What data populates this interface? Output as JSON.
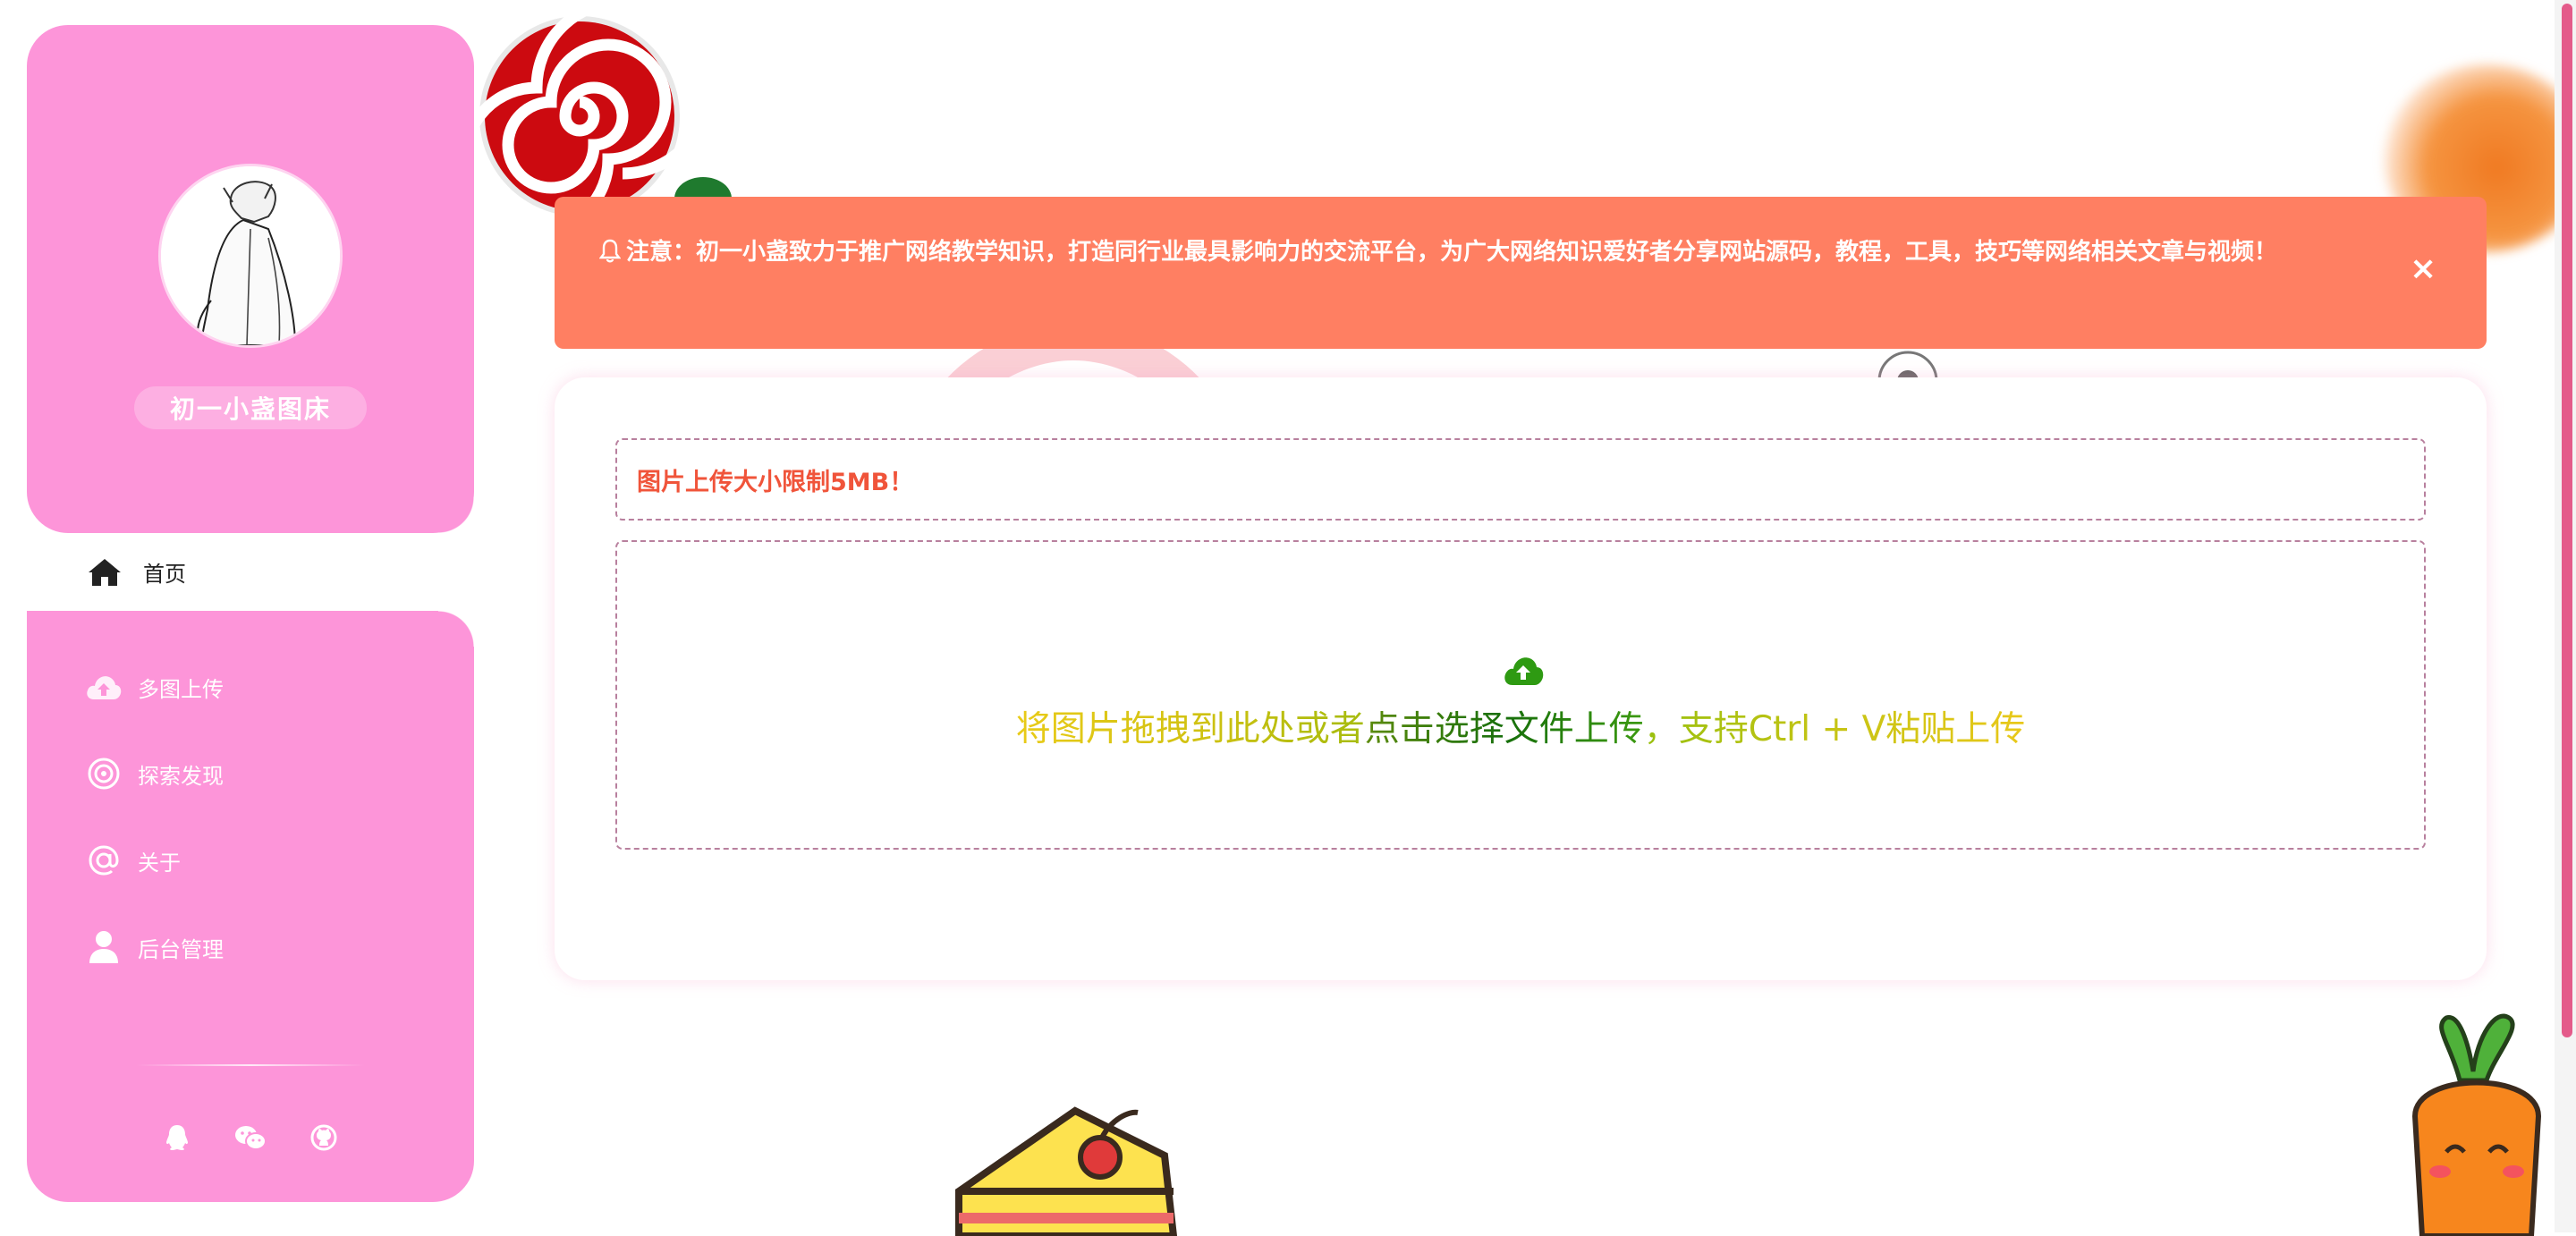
{
  "sidebar": {
    "site_name": "初一小盏图床",
    "nav": [
      {
        "label": "首页",
        "icon": "home-icon",
        "active": true
      },
      {
        "label": "多图上传",
        "icon": "cloud-upload-icon"
      },
      {
        "label": "探索发现",
        "icon": "target-icon"
      },
      {
        "label": "关于",
        "icon": "at-icon"
      },
      {
        "label": "后台管理",
        "icon": "user-icon"
      }
    ],
    "social": [
      "qq-icon",
      "wechat-icon",
      "github-icon"
    ]
  },
  "notice": {
    "text": "注意：初一小盏致力于推广网络教学知识，打造同行业最具影响力的交流平台，为广大网络知识爱好者分享网站源码，教程，工具，技巧等网络相关文章与视频！",
    "close_label": "×"
  },
  "upload": {
    "limit_text": "图片上传大小限制5MB！",
    "drop_text_1": "将图片拖拽到此处或者",
    "drop_text_2": "点击选择文件上传",
    "drop_text_3": "，支持Ctrl + V粘贴上传"
  },
  "colors": {
    "sidebar_bg": "#fd95d9",
    "notice_bg": "#ff7f62",
    "limit_text": "#f0543a",
    "upload_icon": "#2e9a12"
  }
}
